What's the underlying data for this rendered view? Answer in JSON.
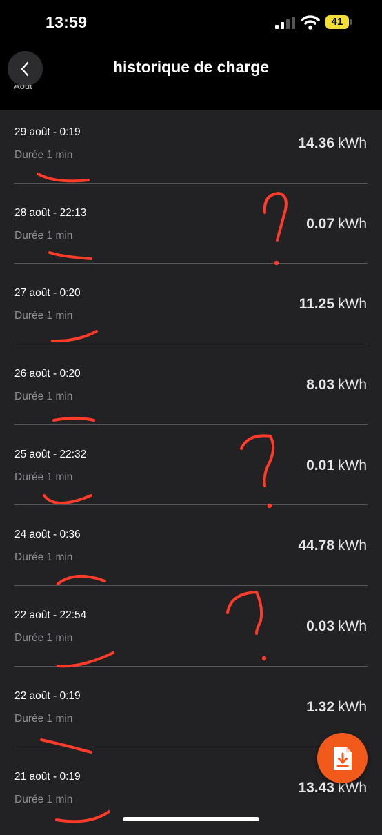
{
  "status_bar": {
    "time": "13:59",
    "battery": "41",
    "battery_color": "#f2dd34"
  },
  "header": {
    "back_icon": "chevron-left-icon",
    "title": "historique de charge",
    "cut_off_text": "Août"
  },
  "sessions": [
    {
      "date": "29 août - 0:19",
      "duration": "Durée 1 min",
      "value": "14.36",
      "unit": "kWh"
    },
    {
      "date": "28 août - 22:13",
      "duration": "Durée 1 min",
      "value": "0.07",
      "unit": "kWh"
    },
    {
      "date": "27 août - 0:20",
      "duration": "Durée 1 min",
      "value": "11.25",
      "unit": "kWh"
    },
    {
      "date": "26 août - 0:20",
      "duration": "Durée 1 min",
      "value": "8.03",
      "unit": "kWh"
    },
    {
      "date": "25 août - 22:32",
      "duration": "Durée 1 min",
      "value": "0.01",
      "unit": "kWh"
    },
    {
      "date": "24 août - 0:36",
      "duration": "Durée 1 min",
      "value": "44.78",
      "unit": "kWh"
    },
    {
      "date": "22 août - 22:54",
      "duration": "Durée 1 min",
      "value": "0.03",
      "unit": "kWh"
    },
    {
      "date": "22 août - 0:19",
      "duration": "Durée 1 min",
      "value": "1.32",
      "unit": "kWh"
    },
    {
      "date": "21 août - 0:19",
      "duration": "Durée 1 min",
      "value": "13.43",
      "unit": "kWh"
    }
  ],
  "fab": {
    "icon": "download-document-icon",
    "color": "#f25a1c"
  },
  "annotation_color": "#ff3b2a"
}
